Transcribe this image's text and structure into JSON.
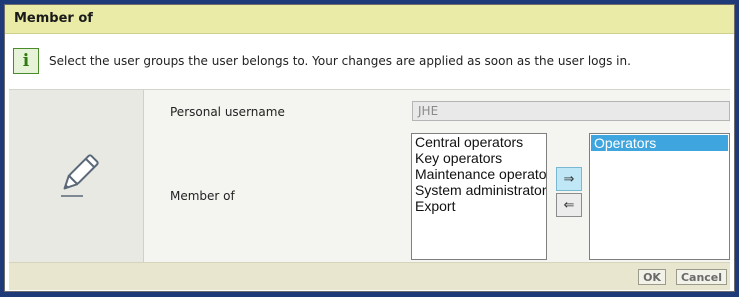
{
  "dialog": {
    "title": "Member of",
    "info_text": "Select the user groups the user belongs to. Your changes are applied as soon as the user logs in."
  },
  "icons": {
    "info": "info-icon",
    "info_glyph": "i",
    "edit": "pencil-icon",
    "move_right_glyph": "⇒",
    "move_left_glyph": "⇐"
  },
  "form": {
    "username_label": "Personal username",
    "username_value": "JHE",
    "member_label": "Member of",
    "available_groups": [
      "Central operators",
      "Key operators",
      "Maintenance operator",
      "System administrator",
      "Export"
    ],
    "selected_groups": [
      "Operators"
    ]
  },
  "footer": {
    "ok_label": "OK",
    "cancel_label": "Cancel"
  },
  "colors": {
    "titlebar": "#e9eba6",
    "selection": "#3fa5df",
    "frame": "#1f3a78",
    "info_green": "#2f7a12"
  }
}
